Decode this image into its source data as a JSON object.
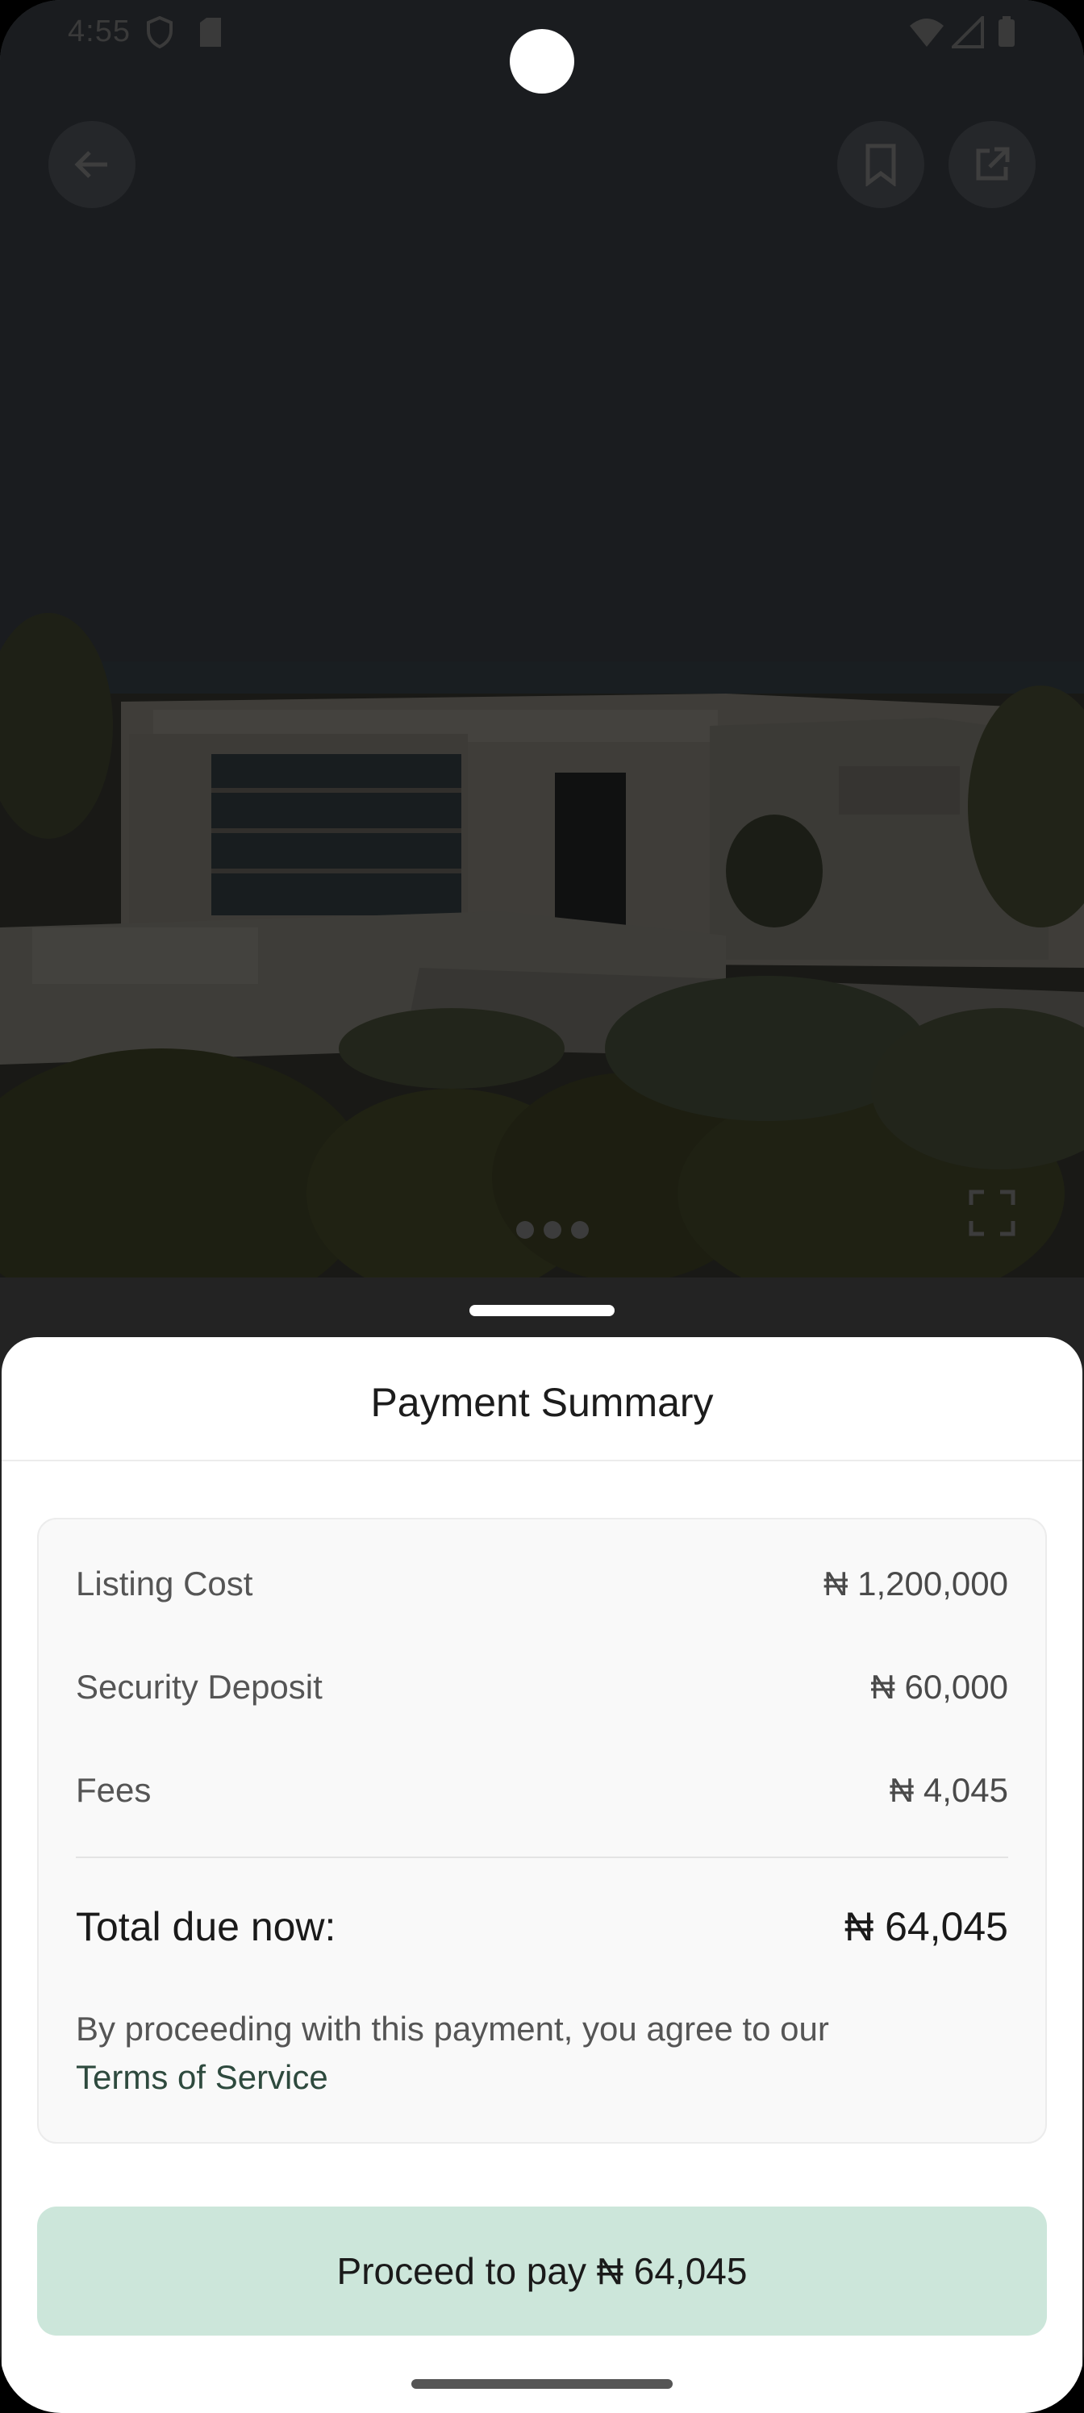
{
  "status_bar": {
    "time": "4:55"
  },
  "sheet": {
    "title": "Payment Summary",
    "rows": [
      {
        "label": "Listing Cost",
        "value": "₦ 1,200,000"
      },
      {
        "label": "Security Deposit",
        "value": "₦ 60,000"
      },
      {
        "label": "Fees",
        "value": "₦ 4,045"
      }
    ],
    "total": {
      "label": "Total due now:",
      "value": "₦ 64,045"
    },
    "agreement_text": "By proceeding with this payment, you agree to our",
    "terms_link": "Terms of Service",
    "proceed_button": "Proceed to pay ₦ 64,045"
  },
  "gallery": {
    "image_count": 3,
    "active_index": 0
  },
  "colors": {
    "accent_button_bg": "#cce6da",
    "link": "#2e4a3e",
    "overlay": "#232323"
  },
  "icons": [
    "back-arrow-icon",
    "bookmark-icon",
    "share-icon",
    "expand-icon",
    "wifi-icon",
    "signal-icon",
    "battery-icon",
    "shield-icon",
    "sim-icon"
  ]
}
